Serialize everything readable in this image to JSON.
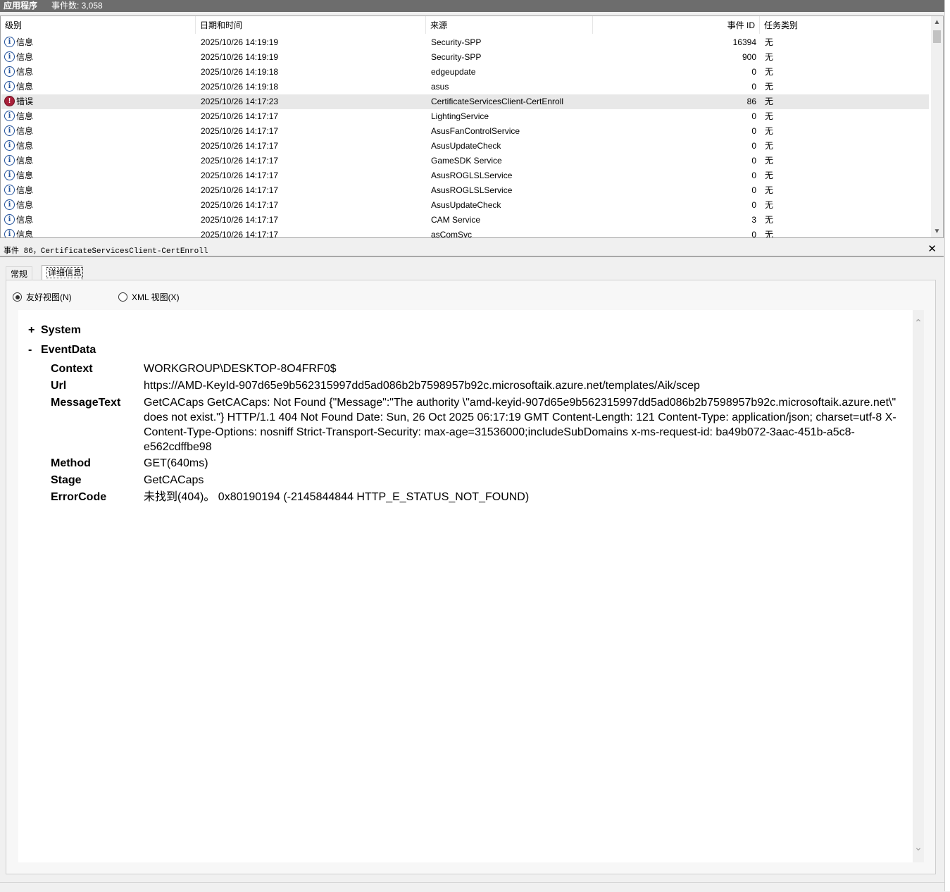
{
  "window": {
    "app_label": "应用程序",
    "event_count_label": "事件数: 3,058"
  },
  "list": {
    "columns": [
      "级别",
      "日期和时间",
      "来源",
      "事件 ID",
      "任务类别"
    ],
    "rows": [
      {
        "level": "信息",
        "icon": "info-icon",
        "datetime": "2025/10/26 14:19:19",
        "source": "Security-SPP",
        "event_id": "16394",
        "task": "无"
      },
      {
        "level": "信息",
        "icon": "info-icon",
        "datetime": "2025/10/26 14:19:19",
        "source": "Security-SPP",
        "event_id": "900",
        "task": "无"
      },
      {
        "level": "信息",
        "icon": "info-icon",
        "datetime": "2025/10/26 14:19:18",
        "source": "edgeupdate",
        "event_id": "0",
        "task": "无"
      },
      {
        "level": "信息",
        "icon": "info-icon",
        "datetime": "2025/10/26 14:19:18",
        "source": "asus",
        "event_id": "0",
        "task": "无"
      },
      {
        "level": "错误",
        "icon": "error-icon",
        "datetime": "2025/10/26 14:17:23",
        "source": "CertificateServicesClient-CertEnroll",
        "event_id": "86",
        "task": "无",
        "selected": true
      },
      {
        "level": "信息",
        "icon": "info-icon",
        "datetime": "2025/10/26 14:17:17",
        "source": "LightingService",
        "event_id": "0",
        "task": "无"
      },
      {
        "level": "信息",
        "icon": "info-icon",
        "datetime": "2025/10/26 14:17:17",
        "source": "AsusFanControlService",
        "event_id": "0",
        "task": "无"
      },
      {
        "level": "信息",
        "icon": "info-icon",
        "datetime": "2025/10/26 14:17:17",
        "source": "AsusUpdateCheck",
        "event_id": "0",
        "task": "无"
      },
      {
        "level": "信息",
        "icon": "info-icon",
        "datetime": "2025/10/26 14:17:17",
        "source": "GameSDK Service",
        "event_id": "0",
        "task": "无"
      },
      {
        "level": "信息",
        "icon": "info-icon",
        "datetime": "2025/10/26 14:17:17",
        "source": "AsusROGLSLService",
        "event_id": "0",
        "task": "无"
      },
      {
        "level": "信息",
        "icon": "info-icon",
        "datetime": "2025/10/26 14:17:17",
        "source": "AsusROGLSLService",
        "event_id": "0",
        "task": "无"
      },
      {
        "level": "信息",
        "icon": "info-icon",
        "datetime": "2025/10/26 14:17:17",
        "source": "AsusUpdateCheck",
        "event_id": "0",
        "task": "无"
      },
      {
        "level": "信息",
        "icon": "info-icon",
        "datetime": "2025/10/26 14:17:17",
        "source": "CAM Service",
        "event_id": "3",
        "task": "无"
      },
      {
        "level": "信息",
        "icon": "info-icon",
        "datetime": "2025/10/26 14:17:17",
        "source": "asComSvc",
        "event_id": "0",
        "task": "无"
      }
    ]
  },
  "detail": {
    "title": "事件 86，CertificateServicesClient-CertEnroll",
    "close_label": "✕",
    "tabs": [
      "常规",
      "详细信息"
    ],
    "active_tab": "详细信息",
    "views": {
      "friendly": "友好视图(N)",
      "xml": "XML 视图(X)",
      "selected": "friendly"
    },
    "system_label": "System",
    "system_sign": "+",
    "eventdata_label": "EventData",
    "eventdata_sign": "-",
    "fields": [
      {
        "key": "Context",
        "value": "WORKGROUP\\DESKTOP-8O4FRF0$"
      },
      {
        "key": "Url",
        "value": "https://AMD-KeyId-907d65e9b562315997dd5ad086b2b7598957b92c.microsoftaik.azure.net/templates/Aik/scep"
      },
      {
        "key": "MessageText",
        "value": "GetCACaps GetCACaps: Not Found {\"Message\":\"The authority \\\"amd-keyid-907d65e9b562315997dd5ad086b2b7598957b92c.microsoftaik.azure.net\\\" does not exist.\"} HTTP/1.1 404 Not Found Date: Sun, 26 Oct 2025 06:17:19 GMT Content-Length: 121 Content-Type: application/json; charset=utf-8 X-Content-Type-Options: nosniff Strict-Transport-Security: max-age=31536000;includeSubDomains x-ms-request-id: ba49b072-3aac-451b-a5c8-e562cdffbe98"
      },
      {
        "key": "Method",
        "value": "GET(640ms)"
      },
      {
        "key": "Stage",
        "value": "GetCACaps"
      },
      {
        "key": "ErrorCode",
        "value": "未找到(404)。 0x80190194 (-2145844844 HTTP_E_STATUS_NOT_FOUND)"
      }
    ]
  }
}
